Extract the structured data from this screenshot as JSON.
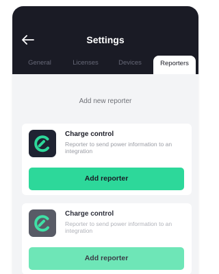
{
  "header": {
    "title": "Settings",
    "back_icon": "arrow-left-icon"
  },
  "tabs": [
    {
      "label": "General",
      "active": false
    },
    {
      "label": "Licenses",
      "active": false
    },
    {
      "label": "Devices",
      "active": false
    },
    {
      "label": "Reporters",
      "active": true
    }
  ],
  "main": {
    "add_new_label": "Add new reporter",
    "reporters": [
      {
        "title": "Charge control",
        "description": "Reporter to send power information to an integration",
        "button_label": "Add reporter",
        "icon": "charge-control-logo-icon"
      },
      {
        "title": "Charge control",
        "description": "Reporter to send power information to an integration",
        "button_label": "Add reporter",
        "icon": "charge-control-logo-icon"
      }
    ]
  },
  "colors": {
    "header_bg": "#1a1b25",
    "accent": "#2dd89a",
    "page_bg": "#f3f4f6"
  }
}
